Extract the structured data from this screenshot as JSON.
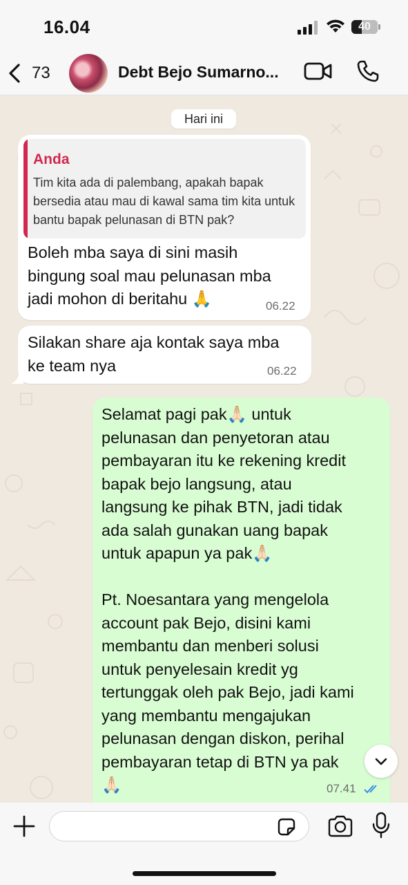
{
  "status_bar": {
    "time": "16.04",
    "battery": "40",
    "battery_level": 0.4
  },
  "header": {
    "back_count": "73",
    "contact_name": "Debt Bejo Sumarno...",
    "icons": [
      "chevron-left-icon",
      "video-camera-icon",
      "phone-icon"
    ]
  },
  "chat": {
    "date_chip": "Hari ini",
    "messages": [
      {
        "direction": "incoming",
        "quote": {
          "author": "Anda",
          "text": "Tim kita ada di palembang, apakah bapak bersedia atau mau di kawal sama tim kita untuk bantu bapak pelunasan di BTN pak?"
        },
        "text": "Boleh mba saya di sini masih\nbingung soal mau pelunasan mba\njadi mohon di beritahu 🙏",
        "time": "06.22"
      },
      {
        "direction": "incoming",
        "text": "Silakan share aja kontak saya mba\nke team nya",
        "time": "06.22"
      },
      {
        "direction": "outgoing",
        "text": "Selamat pagi pak🙏🏻 untuk\npelunasan dan penyetoran atau\npembayaran itu ke rekening kredit\nbapak bejo langsung, atau\nlangsung ke pihak BTN, jadi tidak\nada salah gunakan uang bapak\nuntuk apapun ya pak🙏🏻\n\nPt. Noesantara yang mengelola\naccount pak Bejo, disini kami\nmembantu dan menberi solusi\nuntuk penyelesain kredit yg\ntertunggak oleh pak Bejo, jadi kami\nyang membantu mengajukan\npelunasan dengan diskon, perihal\npembayaran tetap di BTN ya pak\n🙏🏻",
        "time": "07.41",
        "status": "read"
      }
    ]
  },
  "input_bar": {
    "placeholder": "",
    "icons": [
      "plus-icon",
      "sticker-icon",
      "camera-icon",
      "microphone-icon"
    ]
  },
  "colors": {
    "quote_accent": "#d1284f",
    "outgoing_bubble": "#d9fdd3",
    "incoming_bubble": "#ffffff",
    "read_ticks": "#3d8ce6",
    "chat_background": "#efe9df"
  }
}
